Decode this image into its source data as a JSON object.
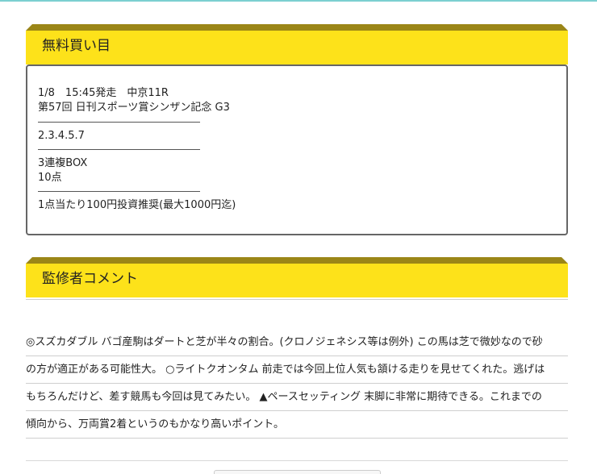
{
  "free_picks": {
    "title": "無料買い目",
    "race_line": "1/8　15:45発走　中京11R",
    "race_name": "第57回 日刊スポーツ賞シンザン記念 G3",
    "horses": "2.3.4.5.7",
    "bet_type": "3連複BOX",
    "points": "10点",
    "stake_note": "1点当たり100円投資推奨(最大1000円迄)"
  },
  "commentary": {
    "title": "監修者コメント",
    "lines": [
      "◎スズカダブル バゴ産駒はダートと芝が半々の割合。(クロノジェネシス等は例外) この馬は芝で微妙なので砂",
      "の方が適正がある可能性大。 ○ライトクオンタム 前走では今回上位人気も頷ける走りを見せてくれた。逃げは",
      "もちろんだけど、差す競馬も今回は見てみたい。 ▲ペースセッティング 末脚に非常に期待できる。これまでの",
      "傾向から、万両賞2着というのもかなり高いポイント。"
    ]
  },
  "colors": {
    "ribbon_yellow": "#fde21a",
    "ribbon_fold": "#9b8617",
    "box_border": "#666666",
    "top_accent": "#7ccfd0"
  }
}
